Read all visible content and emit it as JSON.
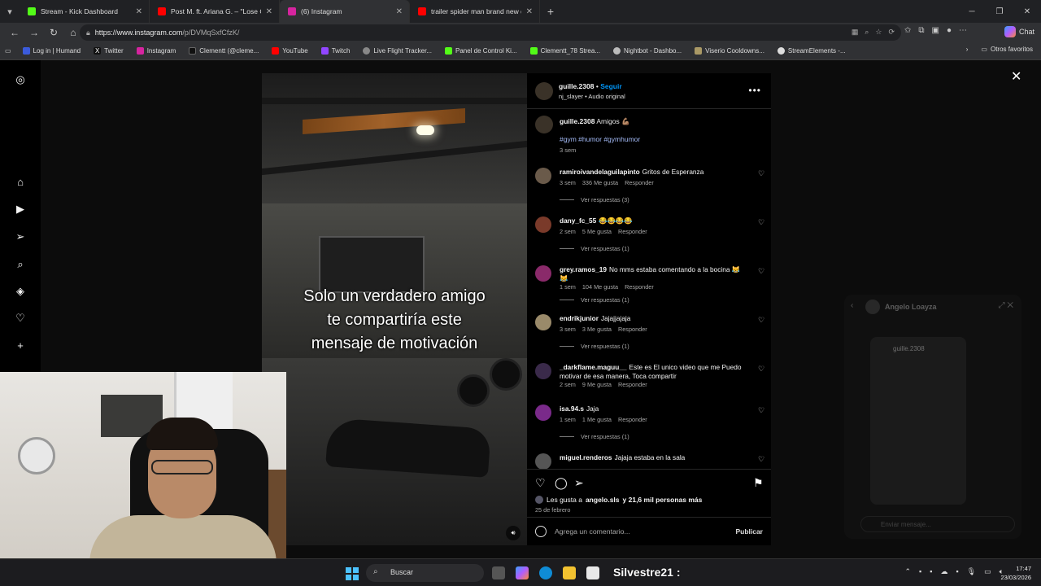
{
  "browser": {
    "tabs": [
      {
        "label": "Stream - Kick Dashboard",
        "color": "#53fc18",
        "active": false
      },
      {
        "label": "Post M. ft. Ariana G. – \"Lose Contr",
        "color": "#ff0000",
        "active": false
      },
      {
        "label": "(6) Instagram",
        "color": "#d6249f",
        "active": true
      },
      {
        "label": "trailer spider man brand new day",
        "color": "#ff0000",
        "active": false
      }
    ],
    "url_host": "https://www.instagram.com",
    "url_path": "/p/DVMqSxfCfzK/",
    "chat_label": "Chat",
    "bookmarks": [
      {
        "label": "Log in | Humand",
        "color": "#3b5bdb"
      },
      {
        "label": "Twitter",
        "color": "#111111"
      },
      {
        "label": "Instagram",
        "color": "#d6249f"
      },
      {
        "label": "Clementt (@cleme...",
        "color": "#111111"
      },
      {
        "label": "YouTube",
        "color": "#ff0000"
      },
      {
        "label": "Twitch",
        "color": "#9146ff"
      },
      {
        "label": "Live Flight Tracker...",
        "color": "#888888"
      },
      {
        "label": "Panel de Control Ki...",
        "color": "#53fc18"
      },
      {
        "label": "Clementt_78 Strea...",
        "color": "#53fc18"
      },
      {
        "label": "Nightbot - Dashbo...",
        "color": "#bbbbbb"
      },
      {
        "label": "Viserio Cooldowns...",
        "color": "#aa9966"
      },
      {
        "label": "StreamElements -...",
        "color": "#dddddd"
      }
    ],
    "other_bookmarks": "Otros favoritos"
  },
  "post": {
    "video_caption": [
      "Solo un verdadero amigo",
      "te compartiría este",
      "mensaje de motivación"
    ],
    "author": "guille.2308",
    "follow": "Seguir",
    "audio_user": "nj_slayer",
    "audio_label": "Audio original",
    "caption_text": "Amigos 💪🏽",
    "hashtags": "#gym #humor #gymhumor",
    "caption_time": "3 sem",
    "comments": [
      {
        "user": "ramiroivandelaguilapinto",
        "text": "Gritos de Esperanza",
        "time": "3 sem",
        "likes": "336 Me gusta",
        "reply": "Responder",
        "replies": "Ver respuestas (3)",
        "avatar_color": "#6a5a4a"
      },
      {
        "user": "dany_fc_55",
        "text": "😂😂😂😂",
        "time": "2 sem",
        "likes": "5 Me gusta",
        "reply": "Responder",
        "replies": "Ver respuestas (1)",
        "avatar_color": "#7a3a2a"
      },
      {
        "user": "grey.ramos_19",
        "text": "No mms estaba comentando a la bocina 😹😹",
        "time": "1 sem",
        "likes": "104 Me gusta",
        "reply": "Responder",
        "replies": "Ver respuestas (1)",
        "avatar_color": "#8a2a6a"
      },
      {
        "user": "endrikjunior",
        "text": "Jajajjajaja",
        "time": "3 sem",
        "likes": "3 Me gusta",
        "reply": "Responder",
        "replies": "Ver respuestas (1)",
        "avatar_color": "#9a8a6a"
      },
      {
        "user": "_darkflame.maguu__",
        "text": "Este es El unico video que me Puedo motivar de esa manera, Toca compartir",
        "time": "2 sem",
        "likes": "9 Me gusta",
        "reply": "Responder",
        "replies": "",
        "avatar_color": "#3a2a4a"
      },
      {
        "user": "isa.94.s",
        "text": "Jaja",
        "time": "1 sem",
        "likes": "1 Me gusta",
        "reply": "Responder",
        "replies": "Ver respuestas (1)",
        "avatar_color": "#7a2a8a"
      },
      {
        "user": "miguel.renderos",
        "text": "Jajaja estaba en la sala",
        "time": "",
        "likes": "",
        "reply": "",
        "replies": "",
        "avatar_color": "#555555"
      }
    ],
    "likes_prefix": "Les gusta a ",
    "likes_user": "angelo.sls",
    "likes_suffix": " y 21,6 mil personas más",
    "date": "25 de febrero",
    "comment_placeholder": "Agrega un comentario...",
    "publish": "Publicar"
  },
  "dm": {
    "name": "Angelo Loayza",
    "shared_user": "guille.2308",
    "input_placeholder": "Enviar mensaje..."
  },
  "taskbar": {
    "search": "Buscar",
    "stream_name": "Silvestre21 :",
    "time": "17:47",
    "date": "23/03/2026"
  }
}
